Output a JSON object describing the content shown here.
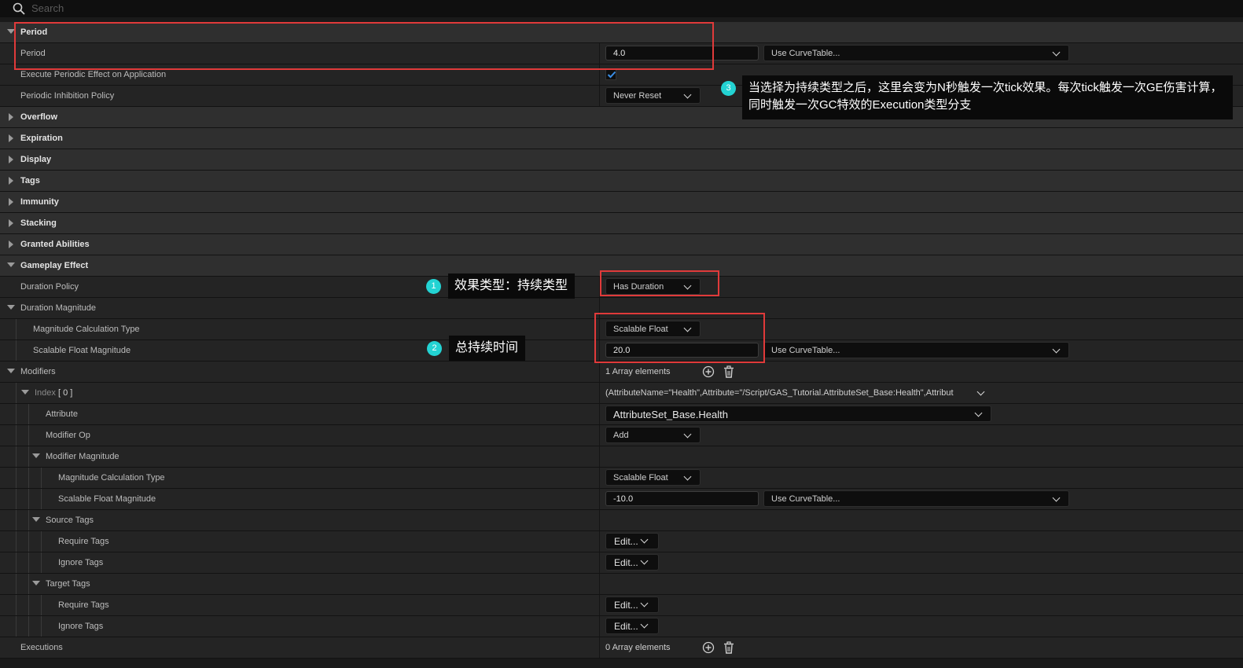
{
  "search": {
    "placeholder": "Search"
  },
  "rows": {
    "period_cat": "Period",
    "period": {
      "label": "Period",
      "value": "4.0",
      "curve": "Use CurveTable..."
    },
    "exec_periodic": {
      "label": "Execute Periodic Effect on Application",
      "checked": true
    },
    "inhibition": {
      "label": "Periodic Inhibition Policy",
      "value": "Never Reset"
    },
    "overflow": "Overflow",
    "expiration": "Expiration",
    "display": "Display",
    "tags": "Tags",
    "immunity": "Immunity",
    "stacking": "Stacking",
    "granted": "Granted Abilities",
    "gameplay_effect": "Gameplay Effect",
    "duration_policy": {
      "label": "Duration Policy",
      "value": "Has Duration"
    },
    "duration_magnitude": "Duration Magnitude",
    "mag_calc_type": {
      "label": "Magnitude Calculation Type",
      "value": "Scalable Float"
    },
    "scalable_float": {
      "label": "Scalable Float Magnitude",
      "value": "20.0",
      "curve": "Use CurveTable..."
    },
    "modifiers": {
      "label": "Modifiers",
      "value": "1 Array elements"
    },
    "index0": {
      "label": "Index",
      "index": "[ 0 ]",
      "value": "(AttributeName=\"Health\",Attribute=\"/Script/GAS_Tutorial.AttributeSet_Base:Health\",Attribut"
    },
    "attribute": {
      "label": "Attribute",
      "value": "AttributeSet_Base.Health"
    },
    "modifier_op": {
      "label": "Modifier Op",
      "value": "Add"
    },
    "modifier_magnitude": "Modifier Magnitude",
    "mod_calc_type": {
      "label": "Magnitude Calculation Type",
      "value": "Scalable Float"
    },
    "mod_scalable": {
      "label": "Scalable Float Magnitude",
      "value": "-10.0",
      "curve": "Use CurveTable..."
    },
    "source_tags": "Source Tags",
    "src_require": {
      "label": "Require Tags",
      "value": "Edit..."
    },
    "src_ignore": {
      "label": "Ignore Tags",
      "value": "Edit..."
    },
    "target_tags": "Target Tags",
    "tgt_require": {
      "label": "Require Tags",
      "value": "Edit..."
    },
    "tgt_ignore": {
      "label": "Ignore Tags",
      "value": "Edit..."
    },
    "executions": {
      "label": "Executions",
      "value": "0 Array elements"
    }
  },
  "annotations": {
    "n1": {
      "num": "1",
      "text": "效果类型：持续类型"
    },
    "n2": {
      "num": "2",
      "text": "总持续时间"
    },
    "n3": {
      "num": "3",
      "text": "当选择为持续类型之后，这里会变为N秒触发一次tick效果。每次tick触发一次GE伤害计算，同时触发一次GC特效的Execution类型分支"
    }
  },
  "colors": {
    "annotation_red": "#e03a3a",
    "badge_cyan": "#23d3d3",
    "check_blue": "#3a8ee6"
  },
  "icons": [
    "search-icon",
    "chevron-down-icon",
    "checkmark-icon",
    "add-circle-icon",
    "trash-icon",
    "expand-arrow-icon",
    "collapse-arrow-icon"
  ]
}
